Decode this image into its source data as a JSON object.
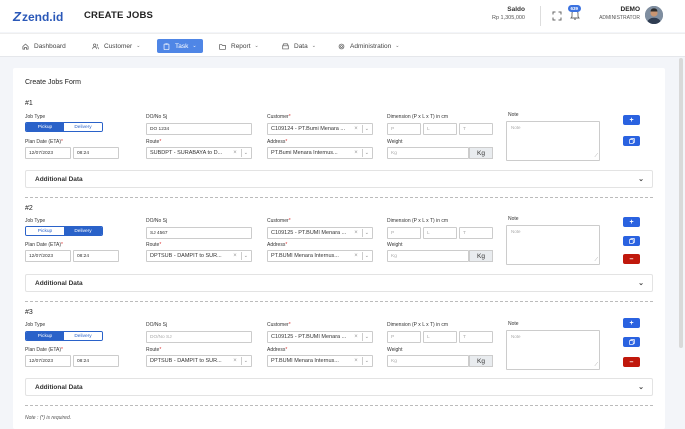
{
  "header": {
    "logo": "zend.id",
    "title": "CREATE JOBS",
    "saldo_label": "Saldo",
    "saldo_amount": "Rp 1,305,000",
    "badge_count": "639",
    "user_name": "DEMO",
    "user_role": "ADMINISTRATOR"
  },
  "nav": {
    "dashboard": "Dashboard",
    "customer": "Customer",
    "task": "Task",
    "report": "Report",
    "data": "Data",
    "administration": "Administration"
  },
  "form": {
    "title": "Create Jobs Form",
    "labels": {
      "job_type": "Job Type",
      "do_no": "DO/No Sj",
      "customer": "Customer",
      "dimension": "Dimension (P x L x T) in cm",
      "note": "Note",
      "plan_date": "Plan Date (ETA)",
      "route": "Route",
      "address": "Address",
      "weight": "Weight",
      "req_mark": "*"
    },
    "toggle": {
      "pickup": "Pickup",
      "delivery": "Delivery"
    },
    "placeholders": {
      "p": "P",
      "l": "L",
      "t": "T",
      "note": "Note",
      "kg": "Kg",
      "weight": "Kg"
    },
    "weight_unit": "Kg",
    "additional_data": "Additional Data",
    "required_note": "Note : (*) is required."
  },
  "jobs": [
    {
      "num": "#1",
      "active_type": "pickup",
      "do_no": "DO 1234",
      "customer": "C109124 - PT.Bumi Menara ...",
      "date": "12/07/2023",
      "time": "08:24",
      "route": "SUBDPT - SURABAYA to D...",
      "address": "PT.Bumi Menara Internus..."
    },
    {
      "num": "#2",
      "active_type": "delivery",
      "do_no": "SJ 4567",
      "customer": "C109125 - PT.BUMI Menara ...",
      "date": "12/07/2023",
      "time": "08:24",
      "route": "DPTSUB - DAMPIT to SUR...",
      "address": "PT.BUMI Menara Internus..."
    },
    {
      "num": "#3",
      "active_type": "pickup",
      "do_no": "DO/No SJ",
      "customer": "C109125 - PT.BUMI Menara ...",
      "date": "12/07/2023",
      "time": "08:24",
      "route": "DPTSUB - DAMPIT to SUR...",
      "address": "PT.BUMI Menara Internus..."
    }
  ]
}
